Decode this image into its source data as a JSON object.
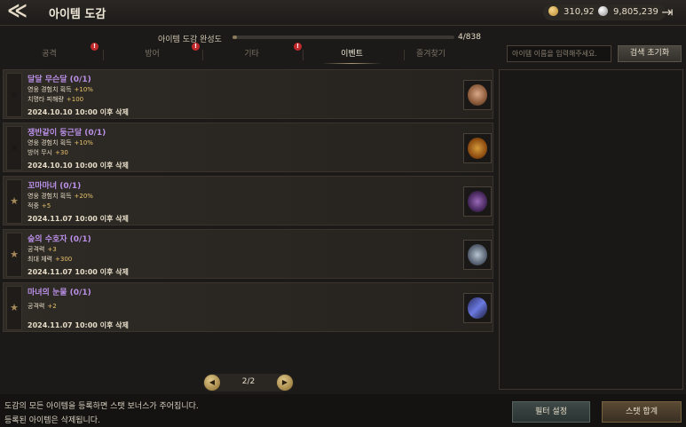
{
  "header": {
    "back_icon": "back-chevron-icon",
    "title": "아이템 도감",
    "gold": "310,926",
    "gems": "9,805,239",
    "exit_icon": "exit-icon"
  },
  "completion": {
    "label": "아이템 도감 완성도",
    "count": "4/838",
    "progress": 0.005
  },
  "tabs": [
    {
      "label": "공격",
      "badge": "!"
    },
    {
      "label": "방어",
      "badge": "!"
    },
    {
      "label": "기타",
      "badge": "!"
    },
    {
      "label": "이벤트"
    },
    {
      "label": "즐겨찾기"
    }
  ],
  "search": {
    "placeholder": "아이템 이름을 입력해주세요.",
    "reset_label": "검색 초기화"
  },
  "items": [
    {
      "name": "달달 무슨달 (0/1)",
      "stats": [
        {
          "label": "영웅 경험치 획득",
          "value": "+10%"
        },
        {
          "label": "치명타 피해량",
          "value": "+100"
        }
      ],
      "date": "2024.10.10 10:00 이후 삭제",
      "star": "★"
    },
    {
      "name": "쟁반같이 둥근달 (0/1)",
      "stats": [
        {
          "label": "영웅 경험치 획득",
          "value": "+10%"
        },
        {
          "label": "방어 무시",
          "value": "+30"
        }
      ],
      "date": "2024.10.10 10:00 이후 삭제",
      "star": "★"
    },
    {
      "name": "꼬마마녀 (0/1)",
      "stats": [
        {
          "label": "영웅 경험치 획득",
          "value": "+20%"
        },
        {
          "label": "적중",
          "value": "+5"
        }
      ],
      "date": "2024.11.07 10:00 이후 삭제",
      "star": "★"
    },
    {
      "name": "숲의 수호자 (0/1)",
      "stats": [
        {
          "label": "공격력",
          "value": "+3"
        },
        {
          "label": "최대 체력",
          "value": "+300"
        }
      ],
      "date": "2024.11.07 10:00 이후 삭제",
      "star": "★"
    },
    {
      "name": "마녀의 눈물 (0/1)",
      "stats": [
        {
          "label": "공격력",
          "value": "+2"
        }
      ],
      "date": "2024.11.07 10:00 이후 삭제",
      "star": "★"
    }
  ],
  "pagination": {
    "text": "2/2",
    "prev": "◀",
    "next": "▶"
  },
  "footer": {
    "info_line1": "도감의 모든 아이템을 등록하면 스탯 보너스가 주어집니다.",
    "info_line2": "등록된 아이템은 삭제됩니다.",
    "filter_label": "필터 설정",
    "stat_sum_label": "스탯 합계"
  },
  "colors": {
    "item_name": "#b98fe6",
    "stat_value": "#e8c36a",
    "star_dark": "#1a1816",
    "star_gold": "#a88a5a",
    "badge": "#c0282c"
  }
}
